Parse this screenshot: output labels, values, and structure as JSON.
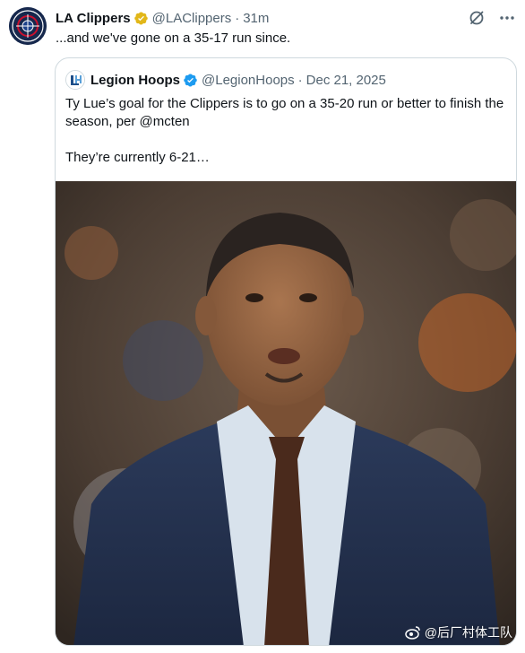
{
  "tweet": {
    "display_name": "LA Clippers",
    "handle": "@LAClippers",
    "separator": "·",
    "time": "31m",
    "text": "...and we've gone on a 35-17 run since."
  },
  "quote": {
    "display_name": "Legion Hoops",
    "handle": "@LegionHoops",
    "separator": "·",
    "date": "Dec 21, 2025",
    "paragraphs": [
      "Ty Lue’s goal for the Clippers is to go on a 35-20 run or better to finish the season, per @mcten",
      "They’re currently 6-21…"
    ],
    "media_alt": "Photo of coach in navy suit and brown tie"
  },
  "watermark": {
    "text": "@后厂村体工队"
  },
  "colors": {
    "text_primary": "#0f1419",
    "text_secondary": "#536471",
    "border": "#cfd9de",
    "verified_gold": "#e2b719",
    "verified_blue": "#1d9bf0",
    "clippers_navy": "#16284d"
  },
  "icons": {
    "avatar": "clippers-logo",
    "gold_badge": "verified-gold-icon",
    "blue_badge": "verified-blue-icon",
    "grok": "grok-icon",
    "more": "more-icon",
    "watermark_logo": "weibo-icon"
  }
}
